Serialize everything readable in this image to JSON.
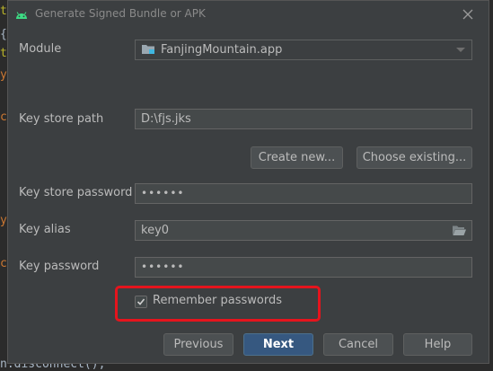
{
  "background": {
    "fragments": [
      "t",
      "{",
      "t",
      "y",
      "c",
      "y",
      "c",
      "n.disconnect();"
    ]
  },
  "dialog": {
    "title": "Generate Signed Bundle or APK",
    "close_icon": "close-icon",
    "module": {
      "label": "Module",
      "value": "FanjingMountain.app"
    },
    "key_store_path": {
      "label": "Key store path",
      "value": "D:\\fjs.jks"
    },
    "create_new_label": "Create new...",
    "choose_existing_label": "Choose existing...",
    "key_store_password": {
      "label": "Key store password",
      "value": "••••••"
    },
    "key_alias": {
      "label": "Key alias",
      "value": "key0"
    },
    "key_password": {
      "label": "Key password",
      "value": "••••••"
    },
    "remember_passwords": {
      "label": "Remember passwords",
      "checked": true
    },
    "buttons": {
      "previous": "Previous",
      "next": "Next",
      "cancel": "Cancel",
      "help": "Help"
    }
  },
  "colors": {
    "dialog_bg": "#3c3f41",
    "primary_button": "#365880",
    "highlight": "#e5141d",
    "android_green": "#3ddc84"
  }
}
